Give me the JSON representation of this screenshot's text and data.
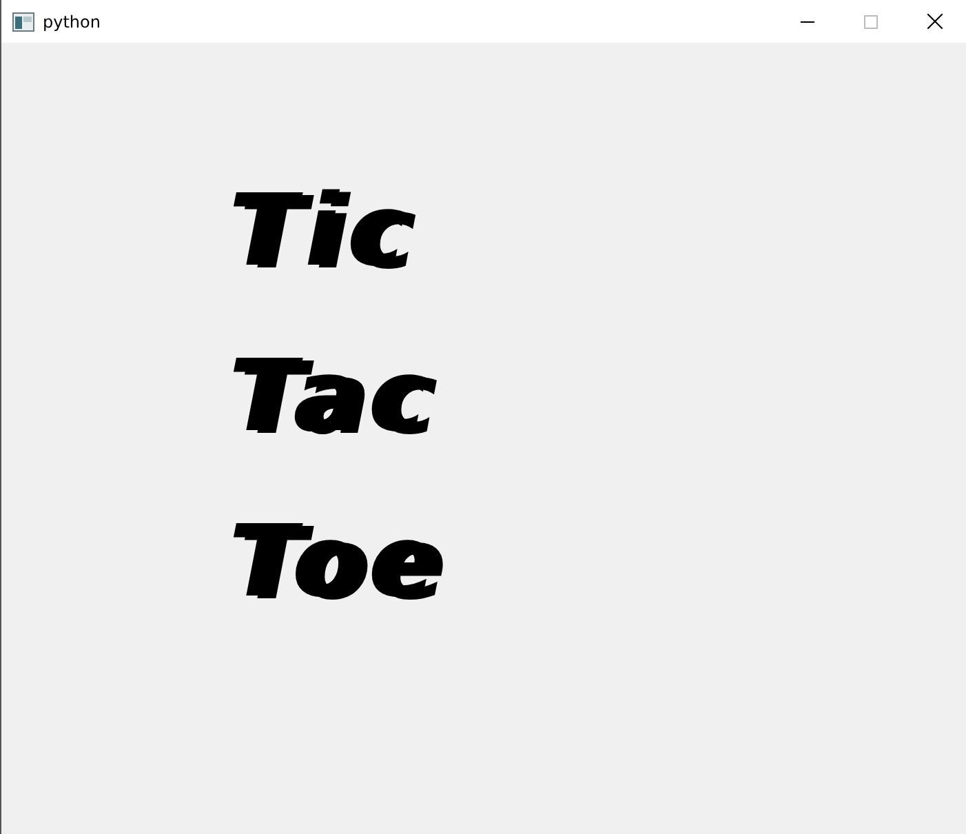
{
  "window": {
    "title": "python"
  },
  "canvas": {
    "lines": [
      "Tic",
      "Tac",
      "Toe"
    ]
  }
}
